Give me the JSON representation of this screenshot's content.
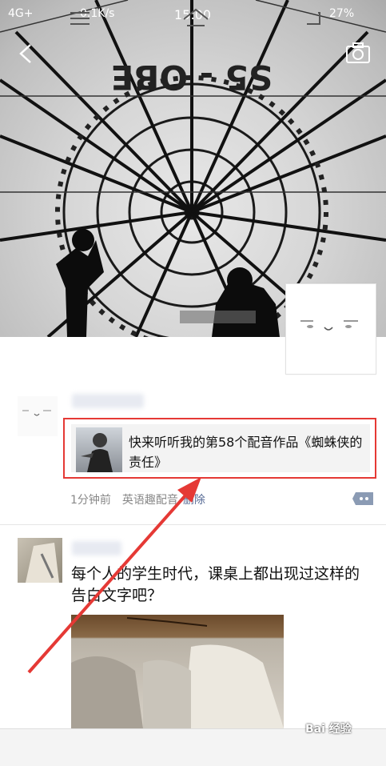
{
  "status_bar": {
    "network": "4G+",
    "speed": "0.1K/s",
    "time": "15:00",
    "battery": "27%"
  },
  "cover": {
    "balloon_lettering": "S5 - OBE"
  },
  "post1": {
    "share_title": "快来听听我的第58个配音作品《蜘蛛侠的责任》",
    "time_ago": "1分钟前",
    "source": "英语趣配音",
    "delete_label": "删除"
  },
  "post2": {
    "text": "每个人的学生时代，课桌上都出现过这样的告白文字吧？"
  },
  "watermark": "Bai 经验",
  "colors": {
    "highlight_border": "#e53935",
    "arrow": "#e53935",
    "link": "#576b95"
  },
  "icons": [
    "back-icon",
    "camera-icon",
    "comment-icon",
    "menu-icon",
    "home-icon",
    "back-nav-icon"
  ]
}
